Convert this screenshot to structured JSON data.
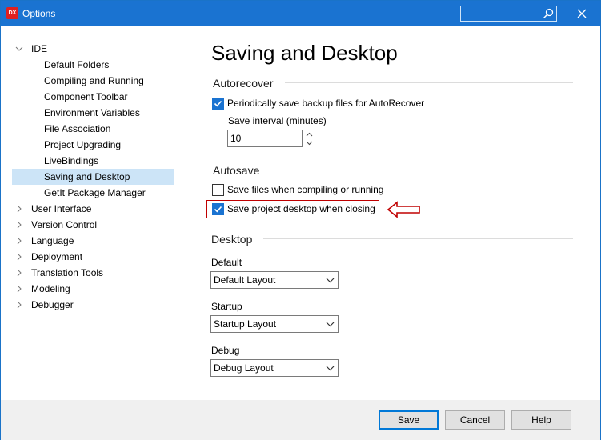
{
  "window": {
    "title": "Options",
    "app_icon_text": "DX",
    "colors": {
      "titlebar": "#1a73d1",
      "selected": "#cce4f7",
      "highlight": "#c00000"
    }
  },
  "tree": {
    "items": [
      {
        "label": "IDE",
        "level": 0,
        "expanded": true
      },
      {
        "label": "Default Folders",
        "level": 1
      },
      {
        "label": "Compiling and Running",
        "level": 1
      },
      {
        "label": "Component Toolbar",
        "level": 1
      },
      {
        "label": "Environment Variables",
        "level": 1
      },
      {
        "label": "File Association",
        "level": 1
      },
      {
        "label": "Project Upgrading",
        "level": 1
      },
      {
        "label": "LiveBindings",
        "level": 1
      },
      {
        "label": "Saving and Desktop",
        "level": 1,
        "selected": true
      },
      {
        "label": "GetIt Package Manager",
        "level": 1
      },
      {
        "label": "User Interface",
        "level": 0,
        "expanded": false
      },
      {
        "label": "Version Control",
        "level": 0,
        "expanded": false
      },
      {
        "label": "Language",
        "level": 0,
        "expanded": false
      },
      {
        "label": "Deployment",
        "level": 0,
        "expanded": false
      },
      {
        "label": "Translation Tools",
        "level": 0,
        "expanded": false
      },
      {
        "label": "Modeling",
        "level": 0,
        "expanded": false
      },
      {
        "label": "Debugger",
        "level": 0,
        "expanded": false
      }
    ]
  },
  "content": {
    "page_title": "Saving and Desktop",
    "autorecover": {
      "title": "Autorecover",
      "periodic_label": "Periodically save backup files for AutoRecover",
      "periodic_checked": true,
      "interval_label": "Save interval (minutes)",
      "interval_value": "10"
    },
    "autosave": {
      "title": "Autosave",
      "save_files_label": "Save files when compiling or running",
      "save_files_checked": false,
      "save_desktop_label": "Save project desktop when closing",
      "save_desktop_checked": true
    },
    "desktop": {
      "title": "Desktop",
      "default_label": "Default",
      "default_value": "Default Layout",
      "startup_label": "Startup",
      "startup_value": "Startup Layout",
      "debug_label": "Debug",
      "debug_value": "Debug Layout"
    }
  },
  "buttons": {
    "save": "Save",
    "cancel": "Cancel",
    "help": "Help"
  }
}
